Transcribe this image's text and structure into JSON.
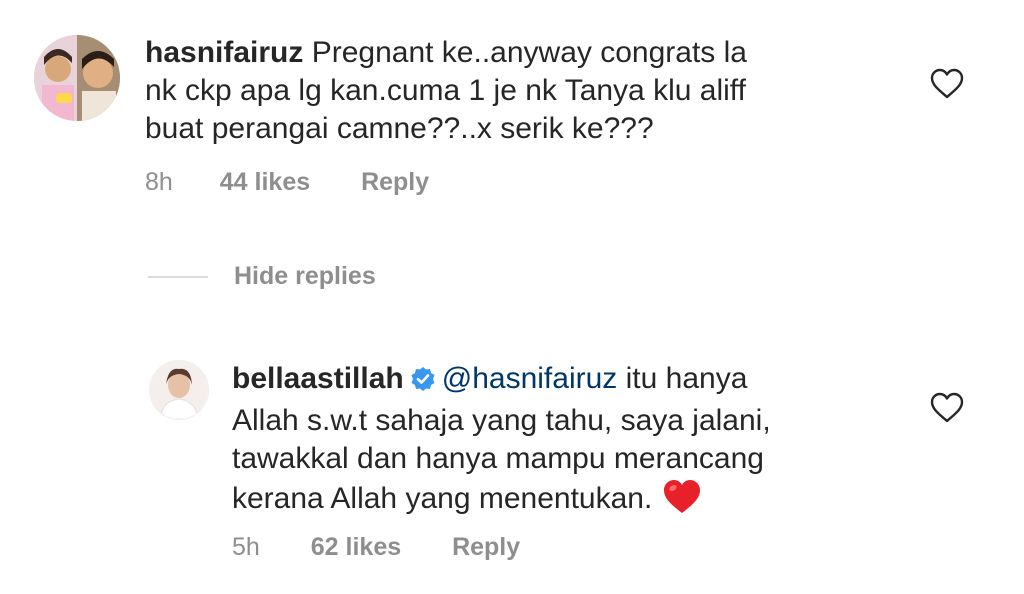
{
  "comments": [
    {
      "username": "hasnifairuz",
      "text_lines": [
        " Pregnant ke..anyway congrats la",
        "nk ckp apa lg kan.cuma 1 je nk Tanya klu aliff",
        "buat perangai camne??..x serik ke???"
      ],
      "time": "8h",
      "likes": "44 likes",
      "reply_label": "Reply",
      "like_icon": "heart-outline-icon"
    },
    {
      "username": "bellaastillah",
      "verified": true,
      "mention": "@hasnifairuz",
      "text_lines": [
        " itu hanya",
        "Allah s.w.t sahaja yang tahu, saya jalani,",
        "tawakkal dan hanya mampu merancang",
        "kerana Allah yang menentukan."
      ],
      "emoji": "red-heart",
      "time": "5h",
      "likes": "62 likes",
      "reply_label": "Reply",
      "like_icon": "heart-outline-icon"
    }
  ],
  "hide_replies_label": "Hide replies",
  "colors": {
    "text": "#262626",
    "secondary": "#8e8e8e",
    "mention": "#00376b",
    "verified": "#3897f0",
    "divider": "#dbdbdb",
    "heart_emoji": "#e8202a"
  }
}
